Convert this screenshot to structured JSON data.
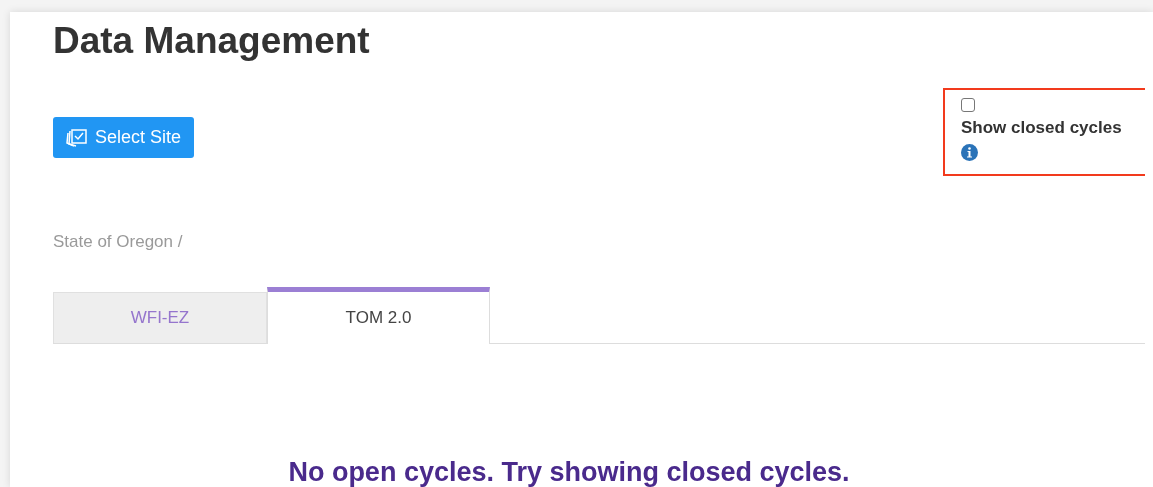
{
  "title": "Data Management",
  "select_site_button": {
    "label": "Select Site"
  },
  "show_closed_cycles": {
    "checked": false,
    "label": "Show closed cycles"
  },
  "breadcrumb": "State of Oregon /",
  "tabs": [
    {
      "label": "WFI-EZ",
      "selected": false
    },
    {
      "label": "TOM 2.0",
      "selected": true
    }
  ],
  "message": "No open cycles. Try showing closed cycles."
}
